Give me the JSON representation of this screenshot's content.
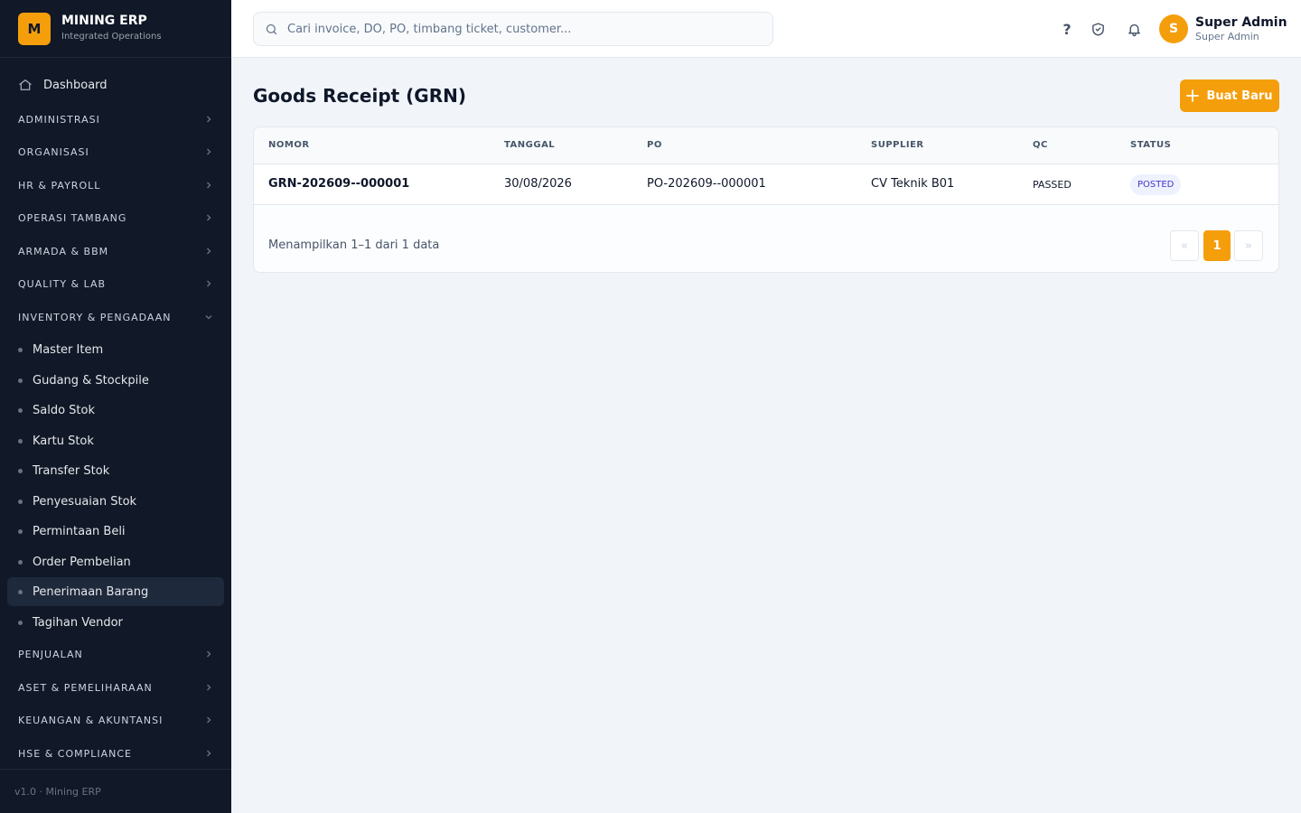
{
  "brand": {
    "logo": "M",
    "name": "MINING ERP",
    "subtitle": "Integrated Operations"
  },
  "sidebar": {
    "dashboard": {
      "label": "Dashboard",
      "icon": "home-icon"
    },
    "groups": [
      {
        "label": "ADMINISTRASI",
        "expanded": false
      },
      {
        "label": "ORGANISASI",
        "expanded": false
      },
      {
        "label": "HR & PAYROLL",
        "expanded": false
      },
      {
        "label": "OPERASI TAMBANG",
        "expanded": false
      },
      {
        "label": "ARMADA & BBM",
        "expanded": false
      },
      {
        "label": "QUALITY & LAB",
        "expanded": false
      },
      {
        "label": "INVENTORY & PENGADAAN",
        "expanded": true
      },
      {
        "label": "PENJUALAN",
        "expanded": false
      },
      {
        "label": "ASET & PEMELIHARAAN",
        "expanded": false
      },
      {
        "label": "KEUANGAN & AKUNTANSI",
        "expanded": false
      },
      {
        "label": "HSE & COMPLIANCE",
        "expanded": false
      }
    ],
    "inventory_items": [
      {
        "label": "Master Item"
      },
      {
        "label": "Gudang & Stockpile"
      },
      {
        "label": "Saldo Stok"
      },
      {
        "label": "Kartu Stok"
      },
      {
        "label": "Transfer Stok"
      },
      {
        "label": "Penyesuaian Stok"
      },
      {
        "label": "Permintaan Beli"
      },
      {
        "label": "Order Pembelian"
      },
      {
        "label": "Penerimaan Barang",
        "active": true
      },
      {
        "label": "Tagihan Vendor"
      }
    ],
    "footer": "v1.0 · Mining ERP"
  },
  "topbar": {
    "search_placeholder": "Cari invoice, DO, PO, timbang ticket, customer...",
    "search_value": "",
    "icons": [
      "help-icon",
      "shield-icon",
      "bell-icon"
    ],
    "help_glyph": "?",
    "user": {
      "initial": "S",
      "name": "Super Admin",
      "role": "Super Admin"
    }
  },
  "main": {
    "title": "Goods Receipt (GRN)",
    "new_button": "Buat Baru",
    "table": {
      "columns": [
        "NOMOR",
        "TANGGAL",
        "PO",
        "SUPPLIER",
        "QC",
        "STATUS"
      ],
      "rows": [
        {
          "nomor": "GRN-202609--000001",
          "tanggal": "30/08/2026",
          "po": "PO-202609--000001",
          "supplier": "CV Teknik B01",
          "qc": "PASSED",
          "status": "POSTED"
        }
      ]
    },
    "pagination": {
      "info": "Menampilkan 1–1 dari 1 data",
      "prev": "«",
      "current": "1",
      "next": "»"
    }
  },
  "colors": {
    "accent": "#f59e0b",
    "sidebar_bg": "#111827",
    "badge_bg": "#eef2ff",
    "badge_text": "#4338ca"
  }
}
